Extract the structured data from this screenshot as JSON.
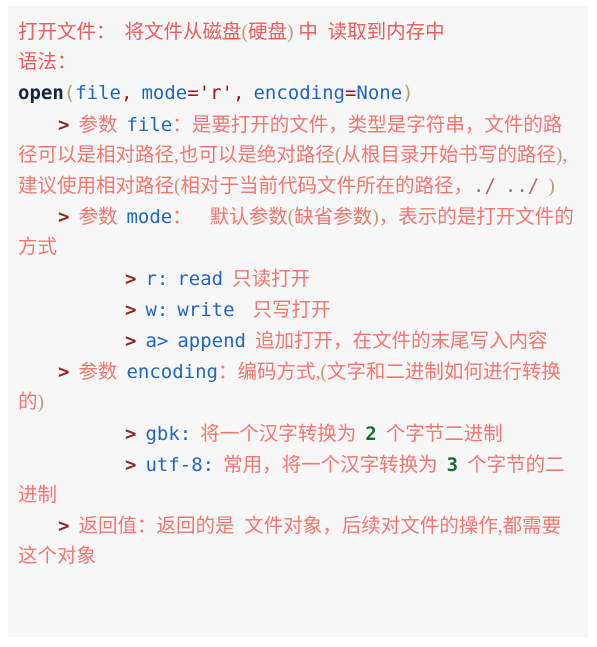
{
  "palette": {
    "background": "#ffffff",
    "card_background": "#f7f7f7",
    "chinese_text": "#f4766f",
    "chinese_heading": "#f05a5a",
    "keyword": "#12263f",
    "identifier": "#1f66c1",
    "operator": "#a41515",
    "paren": "#b9a06a",
    "number": "#176d30",
    "bullet": "#8d2626",
    "path": "#b06a68"
  },
  "note": {
    "heading": {
      "title": "打开文件：",
      "description": "将文件从磁盘",
      "paren_open": "(",
      "paren_text": "硬盘",
      "paren_close": ")",
      "tail": " 中  读取到内存中"
    },
    "syntax_label": "语法：",
    "signature": {
      "func": "open",
      "lparen": "(",
      "arg1": "file",
      "comma1": ",",
      "arg2": "mode",
      "eq1": "=",
      "val2": "'r'",
      "comma2": ",",
      "arg3": "encoding",
      "eq2": "=",
      "val3": "None",
      "rparen": ")"
    },
    "params": [
      {
        "bullet": ">",
        "label": "参数",
        "name": "file",
        "colon": "：",
        "body_1": "是要打开的文件，类型是字符串，文件的路径可以是相对路径,也可以是绝对路径",
        "paren_open": "(",
        "body_2": "从根目录开始书写的路径",
        "paren_close": ")",
        "body_3": ",建议使用相对路径",
        "paren_open_2": "(",
        "body_4": "相对于当前代码文件所在的路径，",
        "path_1": "./",
        "path_2": "../",
        "paren_close_2": ")"
      },
      {
        "bullet": ">",
        "label": "参数",
        "name": "mode",
        "colon": "：",
        "body_1": "默认参数",
        "paren_open": "(",
        "body_2": "缺省参数",
        "paren_close": ")",
        "body_3": "，表示的是打开文件的方式"
      }
    ],
    "mode_values": [
      {
        "bullet": ">",
        "code": "r:",
        "keyword": "read",
        "desc": "只读打开"
      },
      {
        "bullet": ">",
        "code": "w:",
        "keyword": "write",
        "desc": "只写打开"
      },
      {
        "bullet": ">",
        "code": "a>",
        "keyword": "append",
        "desc": "追加打开，在文件的末尾写入内容"
      }
    ],
    "encoding_param": {
      "bullet": ">",
      "label": "参数",
      "name": "encoding",
      "colon": "：",
      "body_1": "编码方式,",
      "paren_open": "(",
      "body_2": "文字和二进制如何进行转换的",
      "paren_close": ")"
    },
    "encoding_values": [
      {
        "bullet": ">",
        "code": "gbk:",
        "pre": "将一个汉字转换为",
        "number": "2",
        "post": "个字节二进制"
      },
      {
        "bullet": ">",
        "code": "utf-8:",
        "pre": "常用，将一个汉字转换为",
        "number": "3",
        "post": "个字节的二进制"
      }
    ],
    "return_value": {
      "bullet": ">",
      "label": "返回值：",
      "body": "返回的是  文件对象，后续对文件的操作,都需要这个对象"
    }
  }
}
